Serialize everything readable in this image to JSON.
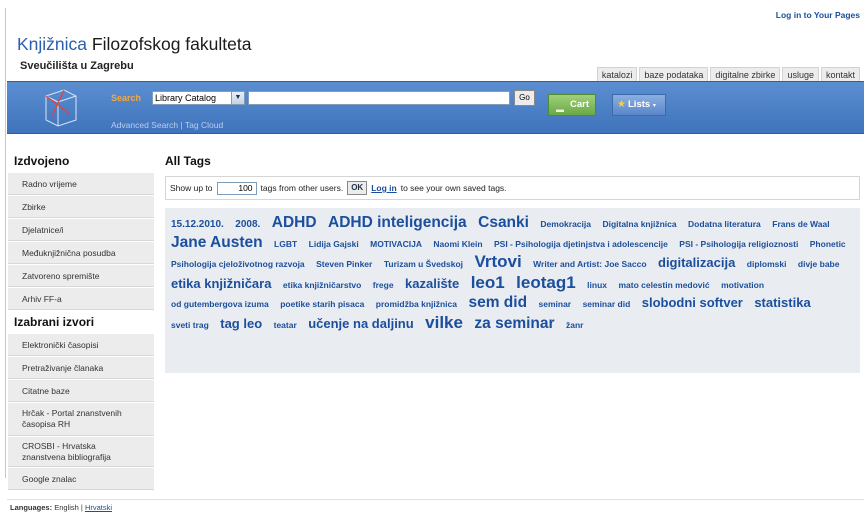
{
  "header": {
    "login": "Log in to Your Pages",
    "title_k": "Knjižnica",
    "title_rest": "Filozofskog fakulteta",
    "subtitle": "Sveučilišta u Zagrebu",
    "nav": [
      "katalozi",
      "baze podataka",
      "digitalne zbirke",
      "usluge",
      "kontakt"
    ]
  },
  "search": {
    "label": "Search",
    "select_value": "Library Catalog",
    "go": "Go",
    "cart": "Cart",
    "lists": "Lists",
    "advanced": "Advanced Search",
    "sep": "|",
    "tagcloud": "Tag Cloud"
  },
  "sidebar": {
    "heading1": "Izdvojeno",
    "items1": [
      "Radno vrijeme",
      "Zbirke",
      "Djelatnice/i",
      "Međuknjižnična posudba",
      "Zatvoreno spremište",
      "Arhiv FF-a"
    ],
    "heading2": "Izabrani izvori",
    "items2": [
      "Elektronički časopisi",
      "Pretraživanje članaka",
      "Citatne baze",
      "Hrčak - Portal znanstvenih časopisa RH",
      "CROSBI - Hrvatska znanstvena bibliografija",
      "Google znalac"
    ]
  },
  "main": {
    "heading": "All Tags",
    "show_up_to": "Show up to",
    "limit": "100",
    "tags_from": "tags from other users.",
    "ok": "OK",
    "login": "Log in",
    "to_see": "to see your own saved tags.",
    "tags": [
      {
        "t": "15.12.2010.",
        "s": 2
      },
      {
        "t": "2008.",
        "s": 2
      },
      {
        "t": "ADHD",
        "s": 4
      },
      {
        "t": "ADHD inteligencija",
        "s": 4
      },
      {
        "t": "Csanki",
        "s": 4
      },
      {
        "t": "Demokracija",
        "s": 1
      },
      {
        "t": "Digitalna knjižnica",
        "s": 1
      },
      {
        "t": "Dodatna literatura",
        "s": 1
      },
      {
        "t": "Frans de Waal",
        "s": 1
      },
      {
        "t": "Jane Austen",
        "s": 4
      },
      {
        "t": "LGBT",
        "s": 1
      },
      {
        "t": "Lidija Gajski",
        "s": 1
      },
      {
        "t": "MOTIVACIJA",
        "s": 1
      },
      {
        "t": "Naomi Klein",
        "s": 1
      },
      {
        "t": "PSI - Psihologija djetinjstva i adolescencije",
        "s": 1
      },
      {
        "t": "PSI - Psihologija religioznosti",
        "s": 1
      },
      {
        "t": "Phonetic",
        "s": 1
      },
      {
        "t": "Psihologija cjeloživotnog razvoja",
        "s": 1
      },
      {
        "t": "Steven Pinker",
        "s": 1
      },
      {
        "t": "Turizam u Švedskoj",
        "s": 1
      },
      {
        "t": "Vrtovi",
        "s": 5
      },
      {
        "t": "Writer and Artist: Joe Sacco",
        "s": 1
      },
      {
        "t": "digitalizacija",
        "s": 3
      },
      {
        "t": "diplomski",
        "s": 1
      },
      {
        "t": "divje babe",
        "s": 1
      },
      {
        "t": "etika knjižničara",
        "s": 3
      },
      {
        "t": "etika knjižničarstvo",
        "s": 1
      },
      {
        "t": "frege",
        "s": 1
      },
      {
        "t": "kazalište",
        "s": 3
      },
      {
        "t": "leo1",
        "s": 5
      },
      {
        "t": "leotag1",
        "s": 5
      },
      {
        "t": "linux",
        "s": 1
      },
      {
        "t": "mato celestin medović",
        "s": 1
      },
      {
        "t": "motivation",
        "s": 1
      },
      {
        "t": "od gutembergova izuma",
        "s": 1
      },
      {
        "t": "poetike starih pisaca",
        "s": 1
      },
      {
        "t": "promidžba knjižnica",
        "s": 1
      },
      {
        "t": "sem did",
        "s": 4
      },
      {
        "t": "seminar",
        "s": 1
      },
      {
        "t": "seminar did",
        "s": 1
      },
      {
        "t": "slobodni softver",
        "s": 3
      },
      {
        "t": "statistika",
        "s": 3
      },
      {
        "t": "sveti trag",
        "s": 1
      },
      {
        "t": "tag leo",
        "s": 3
      },
      {
        "t": "teatar",
        "s": 1
      },
      {
        "t": "učenje na daljinu",
        "s": 3
      },
      {
        "t": "vilke",
        "s": 5
      },
      {
        "t": "za seminar",
        "s": 4
      },
      {
        "t": "žanr",
        "s": 1
      }
    ]
  },
  "footer": {
    "label": "Languages:",
    "english": "English",
    "sep": "|",
    "hrvatski": "Hrvatski"
  },
  "colors": {
    "accent": "#1b4f9d",
    "bar": "#4a7fc6",
    "cart": "#7cb752",
    "tagbg": "#e9ecf0"
  },
  "icons": {
    "logo": "cube-logo-icon",
    "cart": "cart-icon",
    "lists": "star-icon"
  }
}
